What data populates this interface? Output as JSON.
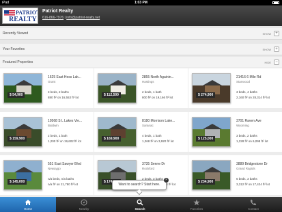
{
  "status_bar": {
    "carrier": "iPad",
    "time": "1:03 PM"
  },
  "header": {
    "logo_line1": "PATRIOT",
    "logo_line2": "REALTY",
    "title": "Patriot Realty",
    "phone": "616-866-7976",
    "separator": " | ",
    "email": "info@patriot-realty.net"
  },
  "sections": [
    {
      "label": "Recently Viewed",
      "toggle": "SHOW",
      "icon": "+"
    },
    {
      "label": "Your Favorites",
      "toggle": "SHOW",
      "icon": "+"
    },
    {
      "label": "Featured Properties",
      "toggle": "HIDE",
      "icon": "−"
    }
  ],
  "listings": [
    {
      "address": "1625 East Hess Lak...",
      "city": "Grant",
      "price": "$ 54,900",
      "beds": "3 beds, 2 baths",
      "sqft": "880 ft² on 16,553 ft² lot",
      "photo_colors": [
        "#8fb6d8",
        "#2e5a1f",
        "#d7d3c8"
      ]
    },
    {
      "address": "2855 North Againin...",
      "city": "Hastings",
      "price": "$ 112,500",
      "beds": "2 beds, 1 bath",
      "sqft": "800 ft² on 19,166 ft² lot",
      "photo_colors": [
        "#9ab3c7",
        "#3b5528",
        "#f0ede4"
      ]
    },
    {
      "address": "21416 6 Mile Rd",
      "city": "Stanwood",
      "price": "$ 274,900",
      "beds": "3 beds, 4 baths",
      "sqft": "2,160 ft² on 28,314 ft² lot",
      "photo_colors": [
        "#c9d5df",
        "#4a3a2a",
        "#8a6a4a"
      ]
    },
    {
      "address": "10568 S L Lakes Vie...",
      "city": "Baldwin",
      "price": "$ 159,900",
      "beds": "2 beds, 1 bath",
      "sqft": "1,200 ft² on 19,602 ft² lot",
      "photo_colors": [
        "#a9c2d6",
        "#3a4c2a",
        "#6b4a30"
      ]
    },
    {
      "address": "8180 Morrison Lake...",
      "city": "Saranac",
      "price": "$ 169,900",
      "beds": "4 beds, 1 bath",
      "sqft": "1,268 ft² on 3,920 ft² lot",
      "photo_colors": [
        "#9fb9cc",
        "#46602f",
        "#5e4030"
      ]
    },
    {
      "address": "3701 Raven Ave",
      "city": "Wyoming",
      "price": "$ 125,000",
      "beds": "3 beds, 2 baths",
      "sqft": "1,228 ft² on 6,098 ft² lot",
      "photo_colors": [
        "#7fa6cc",
        "#5a7a30",
        "#b0b2b4"
      ]
    },
    {
      "address": "551 East Sawyer Blvd",
      "city": "Newaygo",
      "price": "$ 145,000",
      "beds": "n/a beds, n/a baths",
      "sqft": "n/a ft² on 21,780 ft² lot",
      "photo_colors": [
        "#8fb0cf",
        "#5a8a3c",
        "#3c6fa0"
      ]
    },
    {
      "address": "3735 Senne Dr",
      "city": "Rockford",
      "price": "$ 174,900",
      "beds": "2 beds, 3 baths",
      "sqft": "1,480 ft² on 10,454 ft² lot",
      "photo_colors": [
        "#b8c8d4",
        "#39502a",
        "#6e6e6e"
      ]
    },
    {
      "address": "3889 Bridgestone Dr",
      "city": "Grand Rapids",
      "price": "$ 234,900",
      "beds": "6 beds, 3 baths",
      "sqft": "3,312 ft² on 17,424 ft² lot",
      "photo_colors": [
        "#8aa7c0",
        "#3a5a28",
        "#8a7a6a"
      ]
    }
  ],
  "tooltip": {
    "text": "Want to search? Start here.",
    "close": "×"
  },
  "tabs": [
    {
      "label": "Home",
      "icon": "home-icon"
    },
    {
      "label": "Nearby",
      "icon": "compass-icon"
    },
    {
      "label": "Search",
      "icon": "search-icon"
    },
    {
      "label": "Favorites",
      "icon": "star-icon"
    },
    {
      "label": "Contact",
      "icon": "phone-icon"
    }
  ],
  "colors": {
    "active_tab": "#2a78c4",
    "header_bg": "#333333",
    "brand_blue": "#1d3b8c",
    "brand_red": "#c8102e"
  }
}
